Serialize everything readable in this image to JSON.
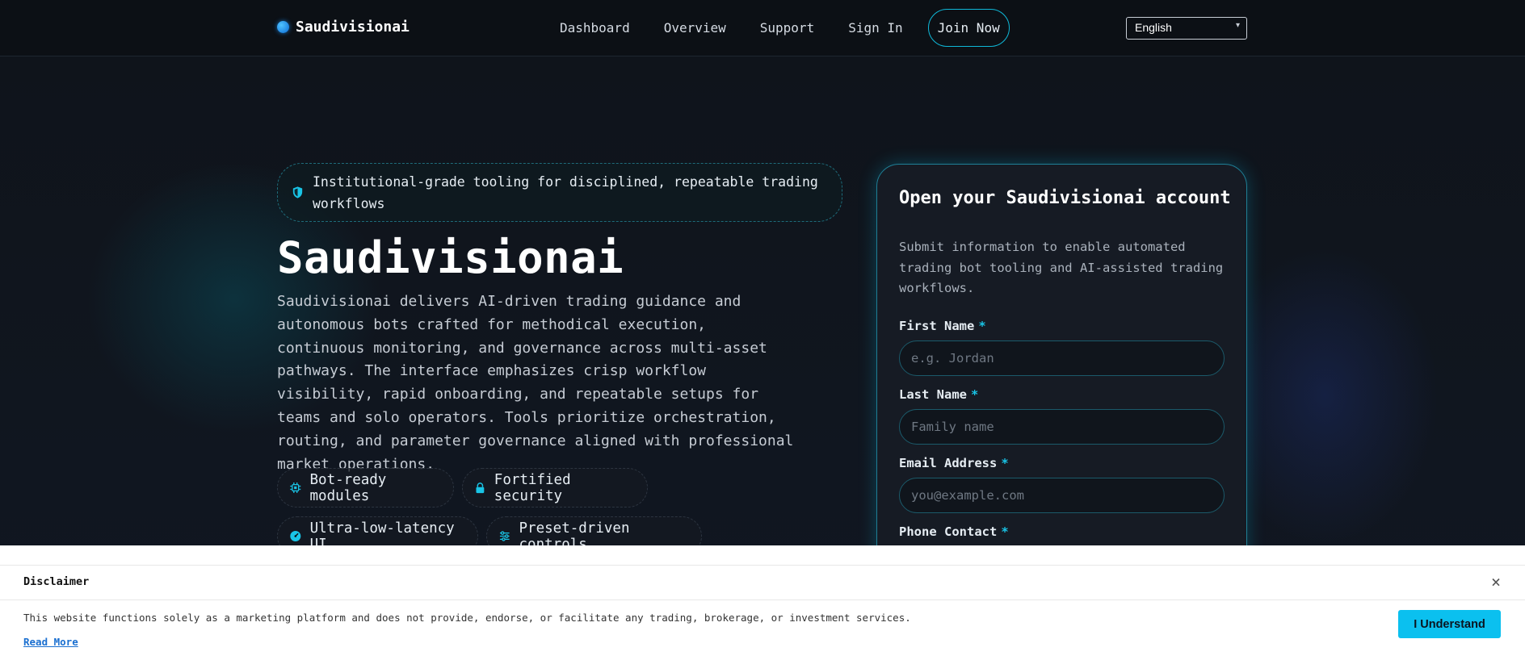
{
  "header": {
    "brand": "Saudivisionai",
    "nav": [
      {
        "label": "Dashboard"
      },
      {
        "label": "Overview"
      },
      {
        "label": "Support"
      },
      {
        "label": "Sign In"
      }
    ],
    "join_label": "Join Now",
    "language": "English"
  },
  "hero": {
    "tagline": "Institutional-grade tooling for disciplined, repeatable trading workflows",
    "title": "Saudivisionai",
    "description": "Saudivisionai delivers AI-driven trading guidance and autonomous bots crafted for methodical execution, continuous monitoring, and governance across multi-asset pathways. The interface emphasizes crisp workflow visibility, rapid onboarding, and repeatable setups for teams and solo operators. Tools prioritize orchestration, routing, and parameter governance aligned with professional market operations.",
    "features": [
      {
        "label": "Bot-ready modules",
        "icon": "chip-icon"
      },
      {
        "label": "Fortified security",
        "icon": "lock-icon"
      },
      {
        "label": "Ultra-low-latency UI",
        "icon": "speedometer-icon"
      },
      {
        "label": "Preset-driven controls",
        "icon": "sliders-icon"
      }
    ]
  },
  "form": {
    "title": "Open your Saudivisionai account",
    "subtitle": "Submit information to enable automated trading bot tooling and AI-assisted trading workflows.",
    "required_mark": "*",
    "first_name": {
      "label": "First Name",
      "placeholder": "e.g. Jordan"
    },
    "last_name": {
      "label": "Last Name",
      "placeholder": "Family name"
    },
    "email": {
      "label": "Email Address",
      "placeholder": "you@example.com"
    },
    "phone": {
      "label": "Phone Contact"
    }
  },
  "disclaimer": {
    "title": "Disclaimer",
    "close": "×",
    "text": "This website functions solely as a marketing platform and does not provide, endorse, or facilitate any trading, brokerage, or investment services.",
    "read_more": "Read More",
    "accept_label": "I Understand"
  },
  "colors": {
    "accent": "#0bc0ef",
    "background": "#0d1117",
    "card": "#161b24"
  }
}
